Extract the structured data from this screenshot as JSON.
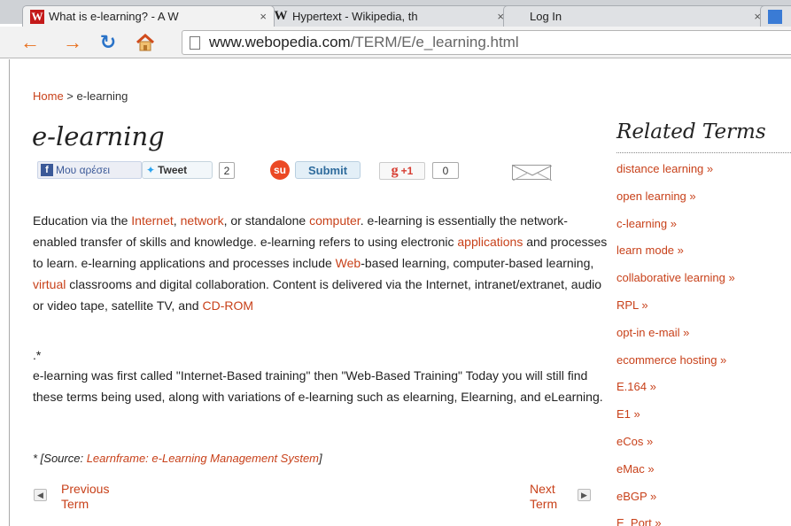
{
  "browser": {
    "tabs": [
      {
        "title": "What is e-learning? - A W",
        "favicon": "webopedia-w-icon",
        "active": true
      },
      {
        "title": "Hypertext - Wikipedia, th",
        "favicon": "wikipedia-w-icon",
        "active": false
      },
      {
        "title": "Log In",
        "favicon": "login-grid-icon",
        "active": false
      }
    ],
    "tab_close": "×",
    "address": {
      "host": "www.webopedia.com",
      "path": "/TERM/E/e_learning.html"
    }
  },
  "page": {
    "breadcrumb": {
      "home": "Home",
      "separator": " > ",
      "current": "e-learning"
    },
    "title": "e-learning",
    "social": {
      "facebook_label": "Μου αρέσει",
      "tweet_label": "Tweet",
      "tweet_count": "2",
      "submit_label": "Submit",
      "gplus_label": "+1",
      "gplus_count": "0"
    },
    "p1": [
      {
        "t": "Education via the "
      },
      {
        "t": "Internet",
        "link": true
      },
      {
        "t": ", "
      },
      {
        "t": "network",
        "link": true
      },
      {
        "t": ", or standalone "
      },
      {
        "t": "computer",
        "link": true
      },
      {
        "t": ". e-learning is essentially the network-enabled transfer of skills and knowledge. e-learning refers to using electronic "
      },
      {
        "t": "applications",
        "link": true
      },
      {
        "t": " and processes to learn. e-learning applications and processes include "
      },
      {
        "t": "Web",
        "link": true
      },
      {
        "t": "-based learning, computer-based learning, "
      },
      {
        "t": "virtual",
        "link": true
      },
      {
        "t": " classrooms and digital collaboration. Content is delivered via the Internet, intranet/extranet, audio or video tape, satellite TV, and "
      },
      {
        "t": "CD-ROM",
        "link": true
      }
    ],
    "footnote_mark": ".*",
    "p2": "e-learning was first called \"Internet-Based training\" then \"Web-Based Training\" Today you will still find these terms being used, along with variations of e-learning such as elearning, Elearning, and eLearning.",
    "source": {
      "prefix": "* [Source: ",
      "link": "Learnframe: e-Learning Management System",
      "suffix": "]"
    },
    "pager": {
      "prev_line1": "Previous",
      "prev_line2": "Term",
      "next_line1": "Next",
      "next_line2": "Term"
    }
  },
  "sidebar": {
    "title": "Related Terms",
    "items": [
      "distance learning »",
      "open learning »",
      "c-learning »",
      "learn mode »",
      "collaborative learning »",
      "RPL »",
      "opt-in e-mail »",
      "ecommerce hosting »",
      "E.164 »",
      "E1 »",
      "eCos »",
      "eMac »",
      "eBGP »",
      "E_Port »"
    ]
  },
  "colors": {
    "link": "#c8411a",
    "facebook": "#3b5998",
    "stumbleupon": "#eb4924",
    "gplus": "#d73d32"
  }
}
